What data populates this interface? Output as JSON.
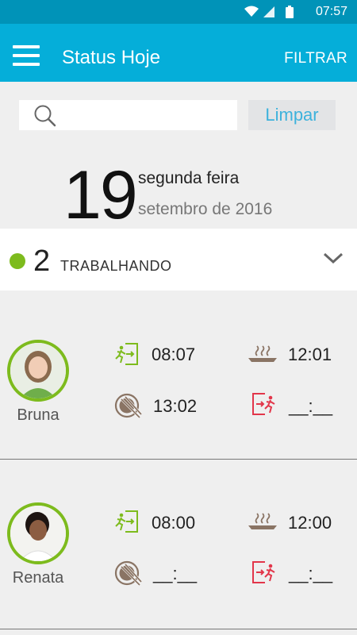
{
  "status_bar": {
    "time": "07:57"
  },
  "app_bar": {
    "title": "Status Hoje",
    "filter_label": "FILTRAR"
  },
  "search": {
    "value": "",
    "placeholder": "",
    "clear_label": "Limpar"
  },
  "date": {
    "day": "19",
    "weekday": "segunda feira",
    "month_year": "setembro de 2016"
  },
  "status": {
    "count": "2",
    "label": "TRABALHANDO",
    "dot_color": "#7dbb1d"
  },
  "employees": [
    {
      "name": "Bruna",
      "entry": "08:07",
      "lunch_start": "12:01",
      "lunch_end": "13:02",
      "exit": "__:__"
    },
    {
      "name": "Renata",
      "entry": "08:00",
      "lunch_start": "12:00",
      "lunch_end": "__:__",
      "exit": "__:__"
    }
  ],
  "colors": {
    "primary": "#05aed9",
    "status_bar": "#0093b8",
    "green": "#7dbb1d",
    "red": "#e2364a",
    "brown": "#8a7464"
  }
}
